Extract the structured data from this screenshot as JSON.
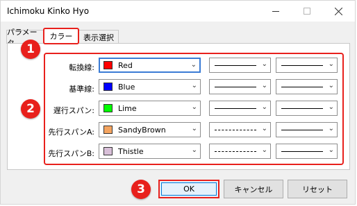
{
  "window": {
    "title": "Ichimoku Kinko Hyo"
  },
  "tabs": [
    {
      "label": "パラメータ"
    },
    {
      "label": "カラー"
    },
    {
      "label": "表示選択"
    }
  ],
  "rows": [
    {
      "label": "転換線:",
      "color_name": "Red",
      "swatch": "#ff0000",
      "line_style": "solid"
    },
    {
      "label": "基準線:",
      "color_name": "Blue",
      "swatch": "#0000ff",
      "line_style": "solid"
    },
    {
      "label": "遅行スパン:",
      "color_name": "Lime",
      "swatch": "#00ff00",
      "line_style": "solid"
    },
    {
      "label": "先行スパンA:",
      "color_name": "SandyBrown",
      "swatch": "#f4a460",
      "line_style": "dashed"
    },
    {
      "label": "先行スパンB:",
      "color_name": "Thistle",
      "swatch": "#d8bfd8",
      "line_style": "dashed"
    }
  ],
  "buttons": {
    "ok": "OK",
    "cancel": "キャンセル",
    "reset": "リセット"
  },
  "badges": [
    "1",
    "2",
    "3"
  ],
  "accent": "#e8201c"
}
